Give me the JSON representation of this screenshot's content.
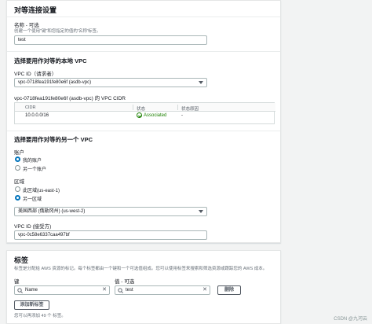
{
  "peering": {
    "section_title": "对等连接设置",
    "name_label": "名称 - 可选",
    "name_hint": "创建一个使用\"键\"和您指定的值的'名称'标签。",
    "name_value": "test",
    "local_vpc_heading": "选择要用作对等的本地 VPC",
    "vpc_id_label": "VPC ID（请求者）",
    "vpc_id_value": "vpc-0718fea191fe80e6f (asdb-vpc)",
    "cidr_title": "vpc-0718fea191fe80e6f (asdb-vpc) 的 VPC CIDR",
    "cidr_table": {
      "headers": [
        "CIDR",
        "状态",
        "状态原因"
      ],
      "rows": [
        [
          "10.0.0.0/16",
          "Associated",
          "-"
        ]
      ]
    },
    "other_vpc_heading": "选择要用作对等的另一个 VPC",
    "account_label": "账户",
    "account_options": [
      "我的账户",
      "另一个账户"
    ],
    "region_label": "区域",
    "region_options": [
      "此区域(us-east-1)",
      "另一区域"
    ],
    "region_select_value": "美国西部 (俄勒冈州) (us-west-2)",
    "accepter_label": "VPC ID (接受方)",
    "accepter_value": "vpc-0c58e6337caa497bf"
  },
  "tags": {
    "section_title": "标签",
    "description": "标签是分配给 AWS 资源的标记。每个标签都由一个键和一个可选值组成。您可以使用标签来搜索和筛选资源或跟踪您的 AWS 成本。",
    "key_label": "键",
    "value_label": "值 - 可选",
    "key_value": "Name",
    "value_value": "test",
    "remove_button": "删除",
    "add_button": "添加新标签",
    "limit_note": "您可以再添加 49 个 标签。"
  },
  "watermark": "CSDN @九河云",
  "colors": {
    "accent": "#0073bb",
    "success": "#1d8102"
  }
}
